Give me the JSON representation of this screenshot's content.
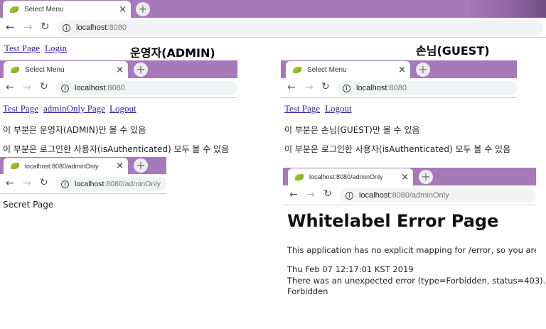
{
  "outer": {
    "tab_title": "Select Menu",
    "url_host": "localhost",
    "url_path": ":8080",
    "links": [
      "Test Page",
      "Login"
    ]
  },
  "labels": {
    "admin": "운영자(ADMIN)",
    "guest": "손님(GUEST)"
  },
  "admin_menu": {
    "tab_title": "Select Menu",
    "url_host": "localhost",
    "url_path": ":8080",
    "links": [
      "Test Page",
      "adminOnly Page",
      "Logout"
    ],
    "line1": "이 부분은 운영자(ADMIN)만 볼 수 있음",
    "line2": "이 부분은 로그인한 사용자(isAuthenticated) 모두 볼 수 있음"
  },
  "admin_only": {
    "tab_title": "localhost:8080/adminOnly",
    "url_host": "localhost",
    "url_path": ":8080/adminOnly",
    "body": "Secret Page"
  },
  "guest_menu": {
    "tab_title": "Select Menu",
    "url_host": "localhost",
    "url_path": ":8080",
    "links": [
      "Test Page",
      "Logout"
    ],
    "line1": "이 부분은 손님(GUEST)만 볼 수 있음",
    "line2": "이 부분은 로그인한 사용자(isAuthenticated) 모두 볼 수 있음"
  },
  "guest_error": {
    "tab_title": "localhost:8080/adminOnly",
    "url_host": "localhost",
    "url_path": ":8080/adminOnly",
    "title": "Whitelabel Error Page",
    "line1": "This application has no explicit mapping for /error, so you are se",
    "line2": "Thu Feb 07 12:17:01 KST 2019",
    "line3": "There was an unexpected error (type=Forbidden, status=403).",
    "line4": "Forbidden"
  },
  "icons": {
    "back": "←",
    "forward": "→",
    "reload": "↻",
    "close": "×",
    "new_tab": "+",
    "info": "i"
  },
  "colors": {
    "tabstrip": "#a679b8",
    "link": "#3a1aa8"
  }
}
